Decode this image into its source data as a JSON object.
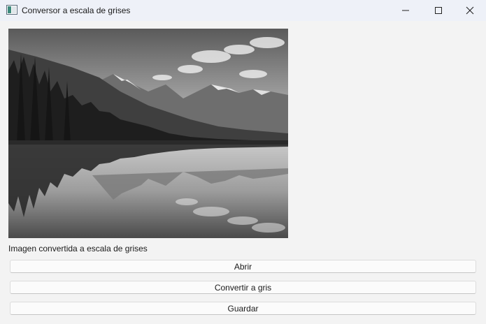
{
  "window": {
    "title": "Conversor a escala de grises",
    "controls": {
      "minimize_icon": "minimize-icon",
      "maximize_icon": "maximize-icon",
      "close_icon": "close-icon"
    }
  },
  "image": {
    "description_icon": "landscape-photo"
  },
  "status_text": "Imagen convertida a escala de grises",
  "buttons": {
    "open": "Abrir",
    "convert": "Convertir a gris",
    "save": "Guardar"
  }
}
